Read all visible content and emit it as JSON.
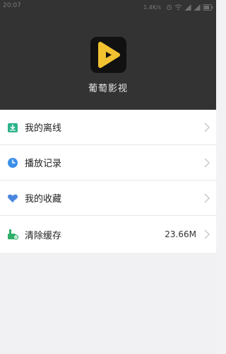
{
  "status_bar": {
    "time": "20:07",
    "network_speed": "1.4K/s"
  },
  "app": {
    "name": "葡萄影视"
  },
  "menu": {
    "items": [
      {
        "label": "我的离线",
        "icon": "download-tray-icon",
        "value": ""
      },
      {
        "label": "播放记录",
        "icon": "clock-icon",
        "value": ""
      },
      {
        "label": "我的收藏",
        "icon": "heart-icon",
        "value": ""
      },
      {
        "label": "清除缓存",
        "icon": "broom-icon",
        "value": "23.66M"
      }
    ]
  },
  "colors": {
    "header_bg": "#333333",
    "accent_yellow": "#f2c230",
    "offline_green": "#2db38c",
    "history_blue": "#3c8fe8",
    "favorite_blue": "#4a86e0",
    "cache_green": "#2fb067"
  }
}
